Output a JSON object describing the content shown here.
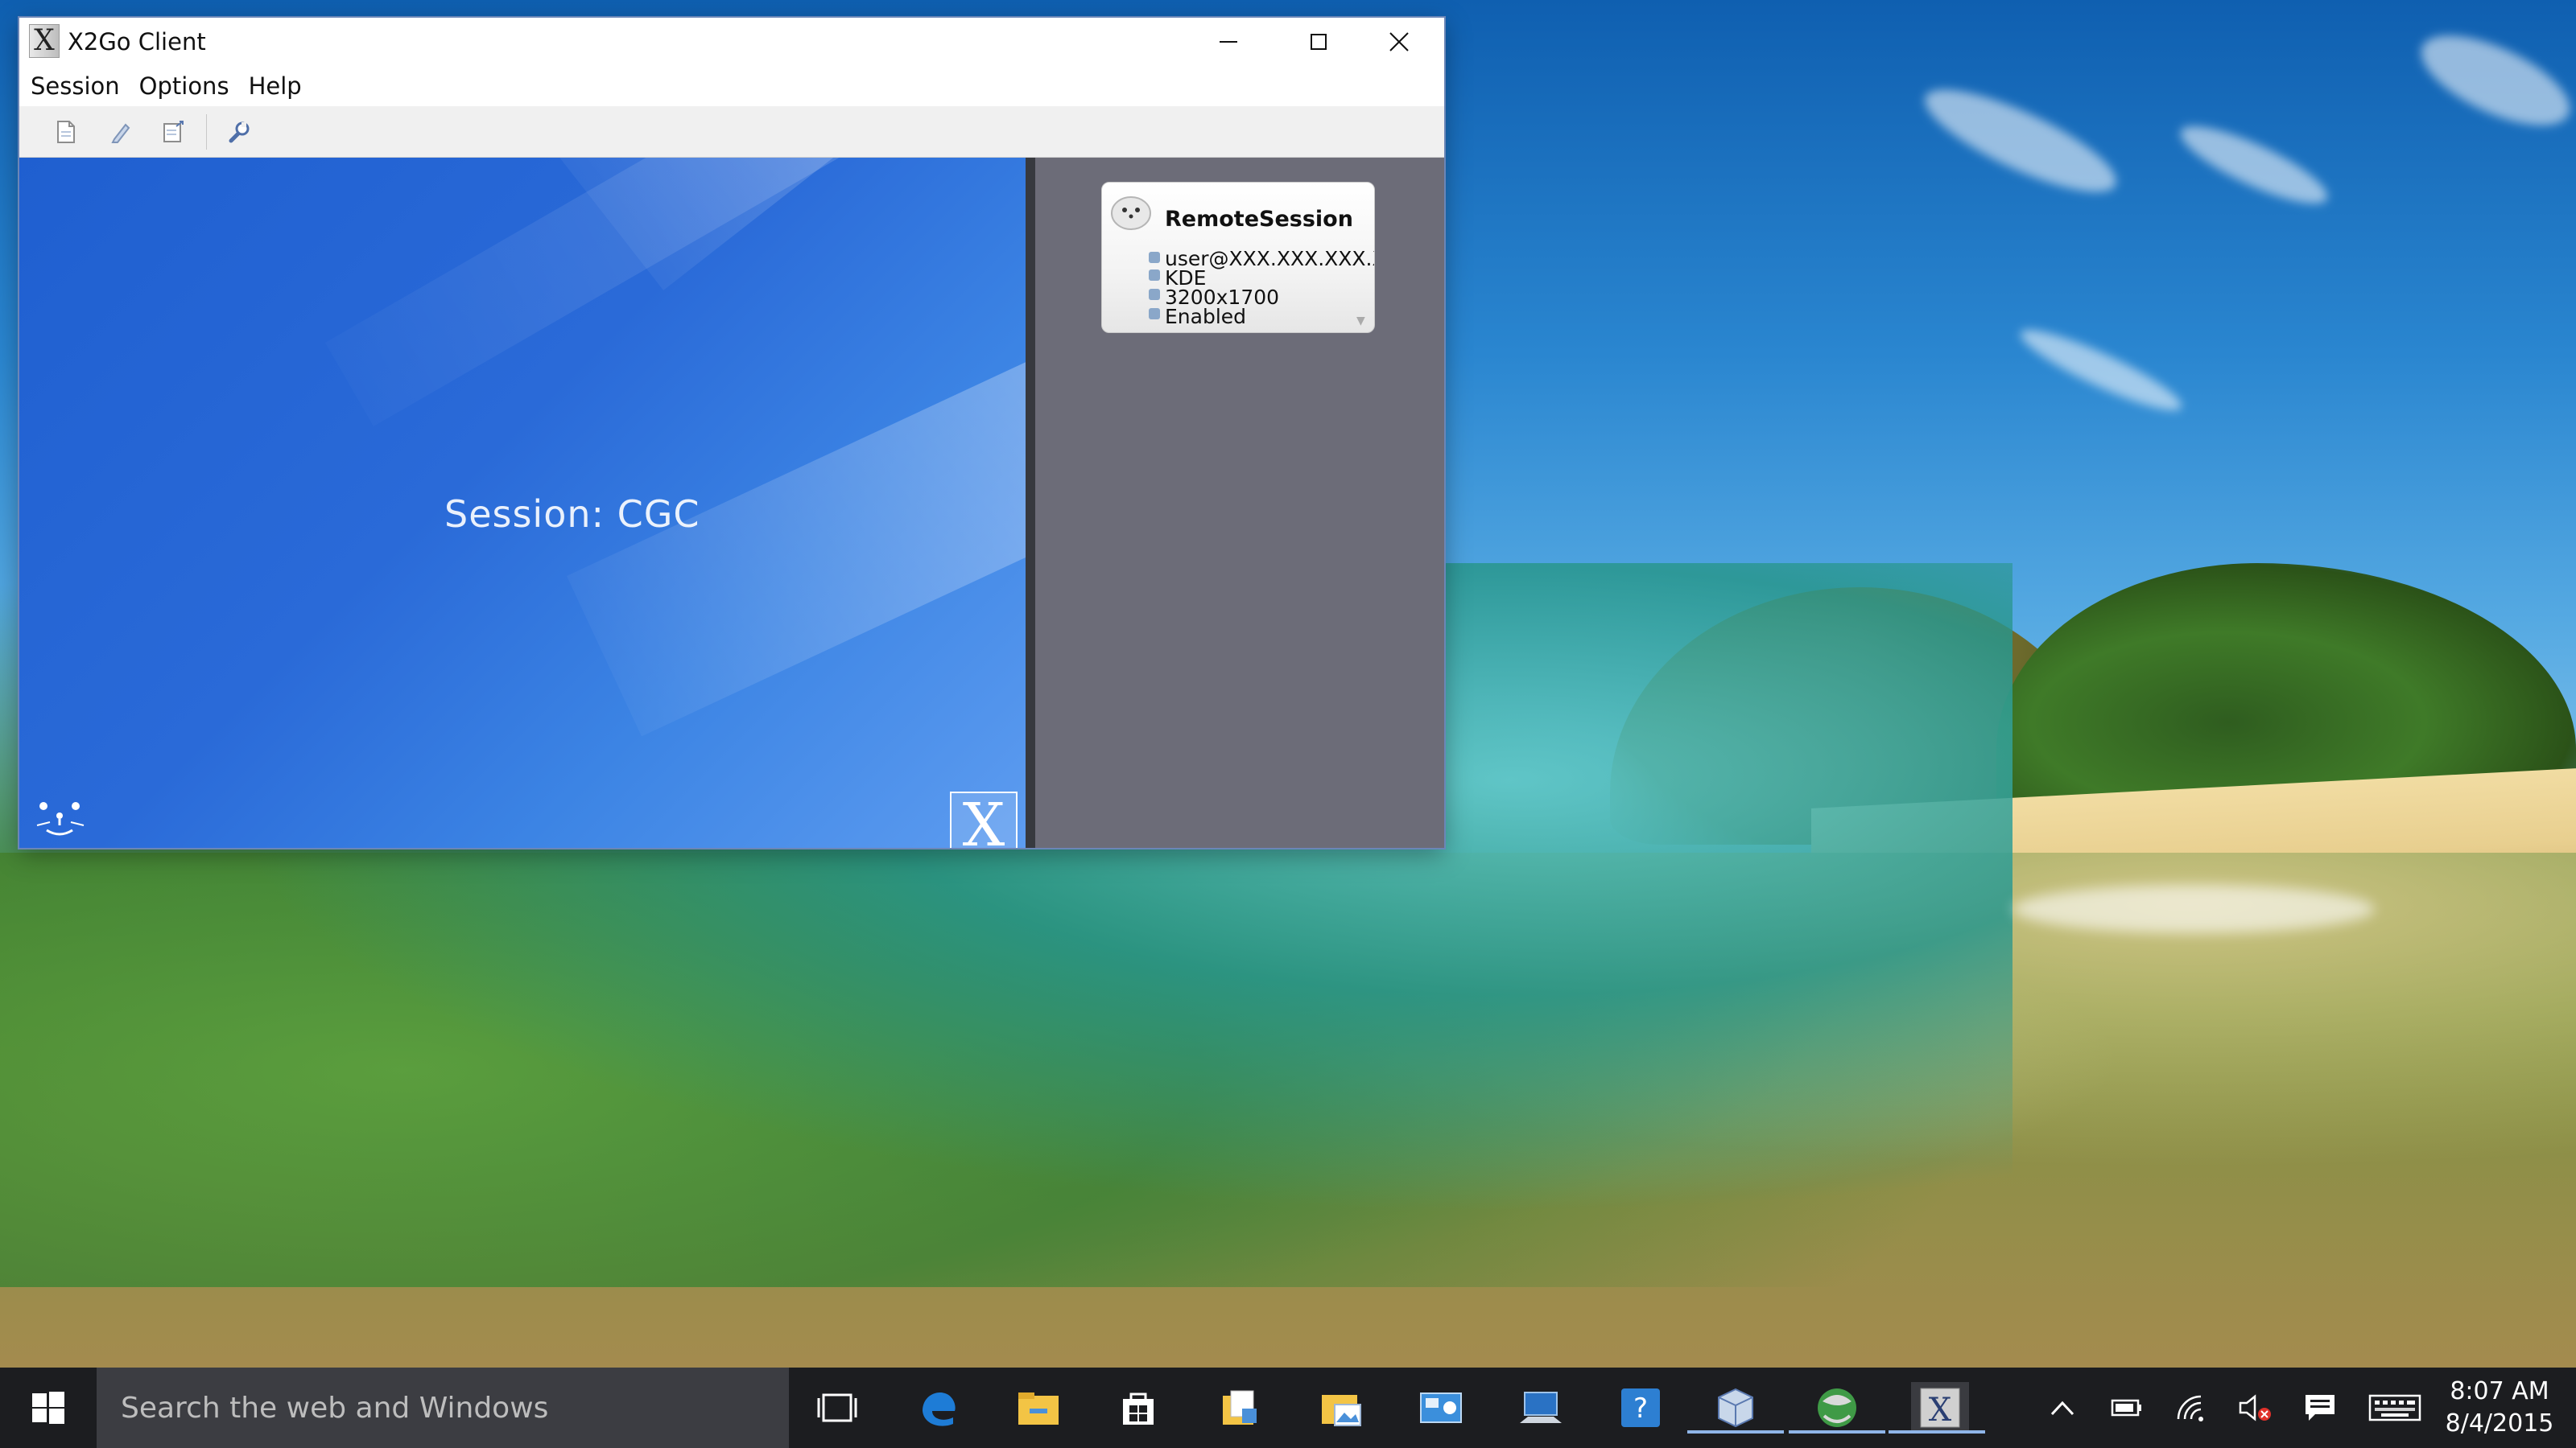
{
  "window": {
    "title": "X2Go Client",
    "app_icon_glyph": "X",
    "minimize_icon": "minimize-icon",
    "maximize_icon": "maximize-icon",
    "close_icon": "close-icon"
  },
  "menu": {
    "items": [
      {
        "label": "Session"
      },
      {
        "label": "Options"
      },
      {
        "label": "Help"
      }
    ]
  },
  "toolbar": {
    "icons": [
      "new-session-icon",
      "edit-session-icon",
      "export-session-icon",
      "preferences-wrench-icon"
    ]
  },
  "banner": {
    "session_label": "Session: CGC",
    "logo_glyph": "X"
  },
  "session_card": {
    "title": "RemoteSession",
    "server": "user@XXX.XXX.XXX.X",
    "session_type": "KDE",
    "resolution": "3200x1700",
    "sound": "Enabled"
  },
  "taskbar": {
    "search_placeholder": "Search the web and Windows",
    "apps": [
      "task-view-icon",
      "edge-icon",
      "store-bag-icon",
      "windows-store-icon",
      "file-explorer-icon",
      "photos-folder-icon",
      "remote-desktop-icon",
      "computer-icon",
      "help-icon",
      "virtualbox-icon",
      "network-globe-icon",
      "x2go-icon"
    ],
    "time": "8:07 AM",
    "date": "8/4/2015"
  },
  "colors": {
    "banner_blue": "#2a6ad8",
    "panel_gray": "#6c6c78",
    "taskbar": "#1c1d20"
  }
}
